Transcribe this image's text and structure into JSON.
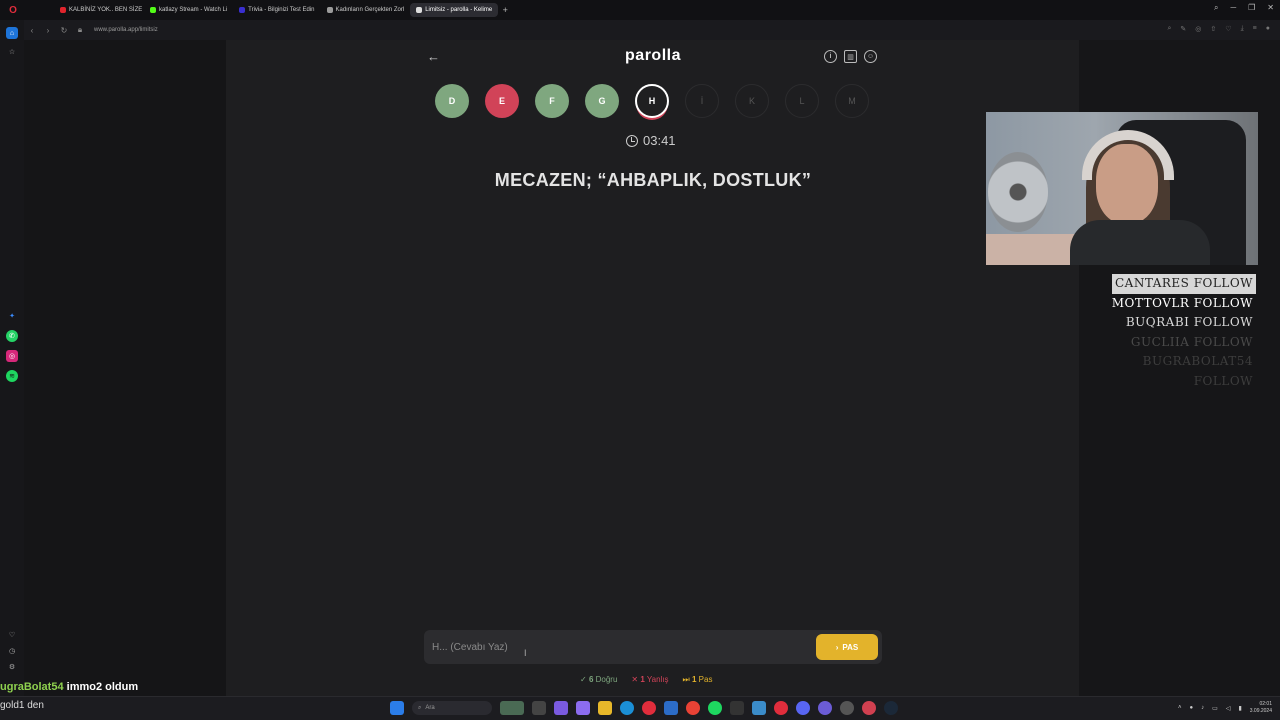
{
  "browser": {
    "tabs": [
      {
        "label": "",
        "color": "#6b5cd6",
        "active": false
      },
      {
        "label": "",
        "color": "#6b5cd6",
        "active": false
      },
      {
        "label": "KALBİNİZ YOK.. BEN SİZE",
        "color": "#e0242c",
        "active": false
      },
      {
        "label": "katlazy Stream - Watch Li",
        "color": "#53fc18",
        "active": false
      },
      {
        "label": "Trivia - Bilginizi Test Edin",
        "color": "#3a2fd0",
        "active": false
      },
      {
        "label": "Kadınların Gerçekten Zorl",
        "color": "#9b9b9b",
        "active": false
      },
      {
        "label": "Limitsiz - parolla - Kelime",
        "color": "#dddddd",
        "active": true
      }
    ],
    "url": "www.parolla.app/limitsiz"
  },
  "app": {
    "title": "parolla",
    "back_icon": "arrow-left-icon",
    "letters": [
      {
        "letter": "D",
        "state": "correct"
      },
      {
        "letter": "E",
        "state": "wrong"
      },
      {
        "letter": "F",
        "state": "correct"
      },
      {
        "letter": "G",
        "state": "correct"
      },
      {
        "letter": "H",
        "state": "current"
      },
      {
        "letter": "İ",
        "state": "pending"
      },
      {
        "letter": "K",
        "state": "pending"
      },
      {
        "letter": "L",
        "state": "pending"
      },
      {
        "letter": "M",
        "state": "pending"
      }
    ],
    "timer": "03:41",
    "question": "MECAZEN; “AHBAPLIK, DOSTLUK”",
    "answer": {
      "placeholder": "H... (Cevabı Yaz)",
      "value": ""
    },
    "pass_button": "PAS",
    "stats": {
      "correct_count": "6",
      "correct_label": "Doğru",
      "wrong_count": "1",
      "wrong_label": "Yanlış",
      "pass_count": "1",
      "pass_label": "Pas"
    },
    "colors": {
      "correct": "#7fa77f",
      "wrong": "#d14358",
      "pass": "#e3b32b"
    }
  },
  "stream": {
    "followers": [
      {
        "name": "CANTARES",
        "action": "FOLLOW",
        "color": "#222222"
      },
      {
        "name": "MOTTOVLR",
        "action": "FOLLOW",
        "color": "#ffffff"
      },
      {
        "name": "BUQRABI",
        "action": "FOLLOW",
        "color": "#d9d9d9"
      },
      {
        "name": "GUCLIIA",
        "action": "FOLLOW",
        "color": "#4a4a4a"
      },
      {
        "name": "BUGRABOLAT54",
        "action": "FOLLOW",
        "color": "#3d3d3d"
      }
    ],
    "chat": [
      {
        "user": "ugraBolat54",
        "message": "immo2 oldum"
      },
      {
        "user": "",
        "message": "gold1 den"
      }
    ]
  },
  "taskbar": {
    "search_placeholder": "Ara",
    "time": "02:01",
    "date": "3.09.2024"
  }
}
